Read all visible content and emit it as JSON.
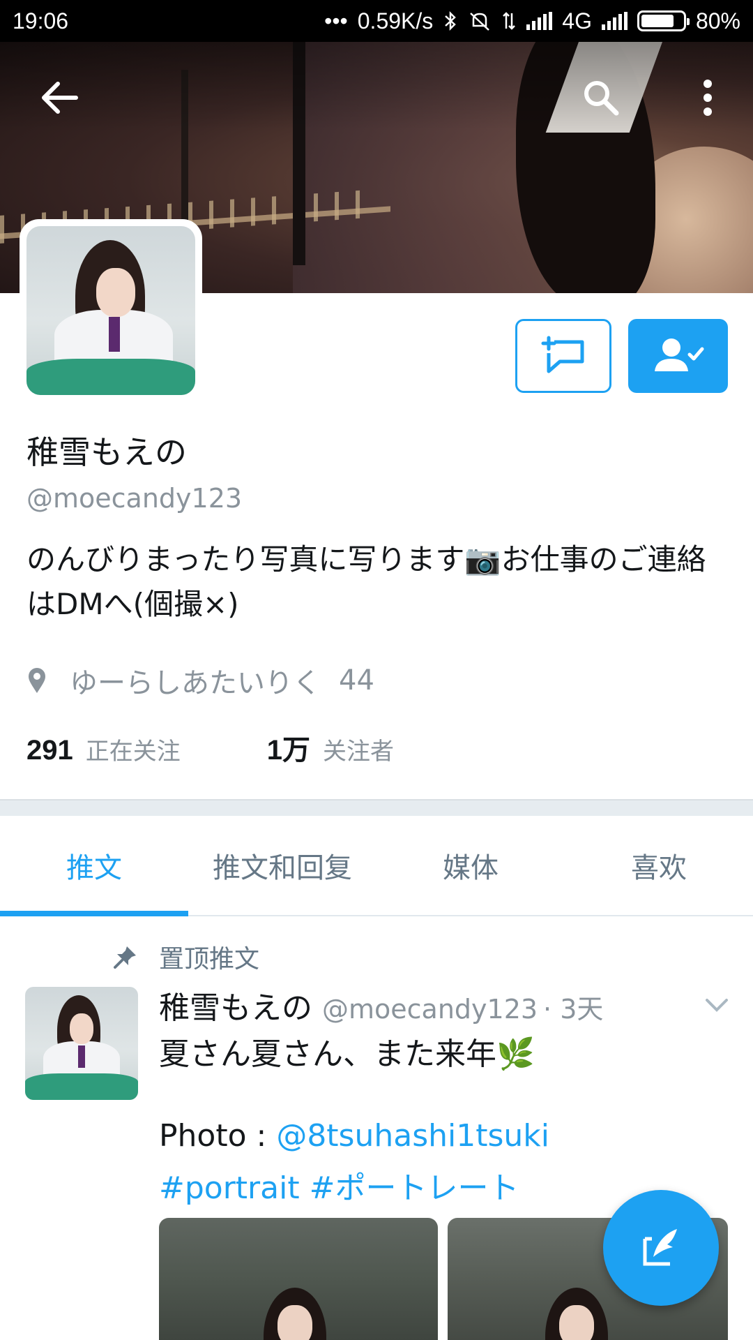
{
  "status_bar": {
    "time": "19:06",
    "dots": "•••",
    "speed": "0.59K/s",
    "network": "4G",
    "battery": "80%",
    "battery_level": 0.8
  },
  "header": {
    "back_icon": "arrow-left-icon",
    "search_icon": "search-icon",
    "more_icon": "more-vertical-icon"
  },
  "profile": {
    "display_name": "稚雪もえの",
    "handle": "@moecandy123",
    "bio": "のんびりまったり写真に写ります📷お仕事のご連絡はDMへ(個撮×)",
    "location": "ゆーらしあたいりく",
    "location_extra": "44",
    "following_count": "291",
    "following_label": "正在关注",
    "followers_count": "1万",
    "followers_label": "关注者"
  },
  "actions": {
    "dm_icon": "message-plus-icon",
    "follow_icon": "user-following-icon"
  },
  "tabs": [
    {
      "label": "推文",
      "active": true
    },
    {
      "label": "推文和回复",
      "active": false
    },
    {
      "label": "媒体",
      "active": false
    },
    {
      "label": "喜欢",
      "active": false
    }
  ],
  "tweet": {
    "pinned_label": "置顶推文",
    "author_name": "稚雪もえの",
    "author_handle": "@moecandy123",
    "time": "· 3天",
    "text": "夏さん夏さん、また来年🌿",
    "photo_prefix": "Photo : ",
    "photo_credit": "@8tsuhashi1tsuki",
    "hashtags": [
      "#portrait",
      "#ポートレート"
    ]
  },
  "colors": {
    "accent": "#1da1f2",
    "muted": "#8a939b"
  }
}
